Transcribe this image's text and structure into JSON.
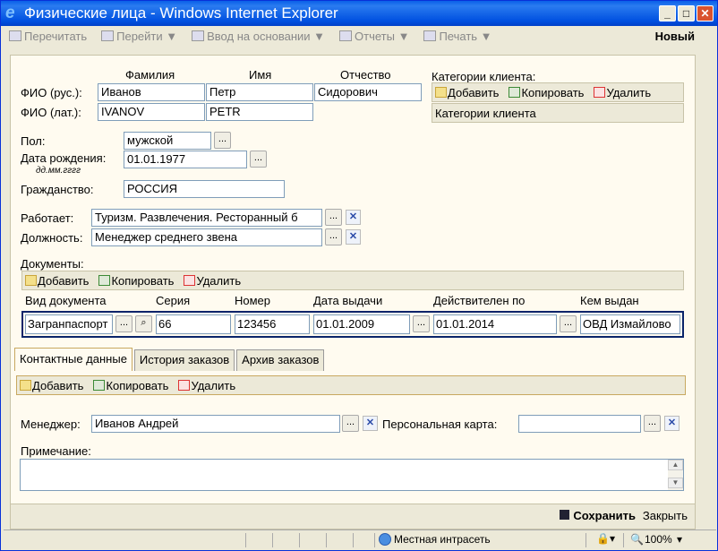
{
  "window": {
    "title": "Физические лица - Windows Internet Explorer",
    "ie_icon": "ie-logo-icon",
    "minimize": "_",
    "maximize": "□",
    "close": "✕"
  },
  "toolbar": {
    "reread": "Перечитать",
    "goto": "Перейти ▼",
    "enter_basis": "Ввод на основании ▼",
    "reports": "Отчеты ▼",
    "print": "Печать ▼",
    "new_label": "Новый"
  },
  "name": {
    "col_last": "Фамилия",
    "col_first": "Имя",
    "col_middle": "Отчество",
    "rus_label": "ФИО (рус.):",
    "lat_label": "ФИО (лат.):",
    "rus_last": "Иванов",
    "rus_first": "Петр",
    "rus_middle": "Сидорович",
    "lat_last": "IVANOV",
    "lat_first": "PETR",
    "lat_middle": ""
  },
  "categories": {
    "label": "Категории клиента:",
    "add": "Добавить",
    "copy": "Копировать",
    "delete": "Удалить",
    "header": "Категории клиента"
  },
  "person": {
    "gender_label": "Пол:",
    "gender": "мужской",
    "birth_label": "Дата рождения:",
    "birth_hint": "дд.мм.гггг",
    "birth": "01.01.1977",
    "citizenship_label": "Гражданство:",
    "citizenship": "РОССИЯ",
    "works_label": "Работает:",
    "works": "Туризм. Развлечения. Ресторанный б",
    "position_label": "Должность:",
    "position": "Менеджер среднего звена"
  },
  "documents": {
    "label": "Документы:",
    "add": "Добавить",
    "copy": "Копировать",
    "delete": "Удалить",
    "columns": [
      "Вид документа",
      "Серия",
      "Номер",
      "Дата выдачи",
      "Действителен по",
      "Кем выдан"
    ],
    "row": {
      "type": "Загранпаспорт",
      "series": "66",
      "number": "123456",
      "issued": "01.01.2009",
      "valid": "01.01.2014",
      "issuer": "ОВД Измайлово"
    }
  },
  "tabs": [
    "Контактные данные",
    "История заказов",
    "Архив заказов"
  ],
  "contacts": {
    "add": "Добавить",
    "copy": "Копировать",
    "delete": "Удалить"
  },
  "manager": {
    "label": "Менеджер:",
    "value": "Иванов Андрей",
    "card_label": "Персональная карта:",
    "card": ""
  },
  "note": {
    "label": "Примечание:"
  },
  "footer": {
    "save": "Сохранить",
    "close": "Закрыть"
  },
  "status": {
    "zone": "Местная интрасеть",
    "zoom": "100%"
  }
}
